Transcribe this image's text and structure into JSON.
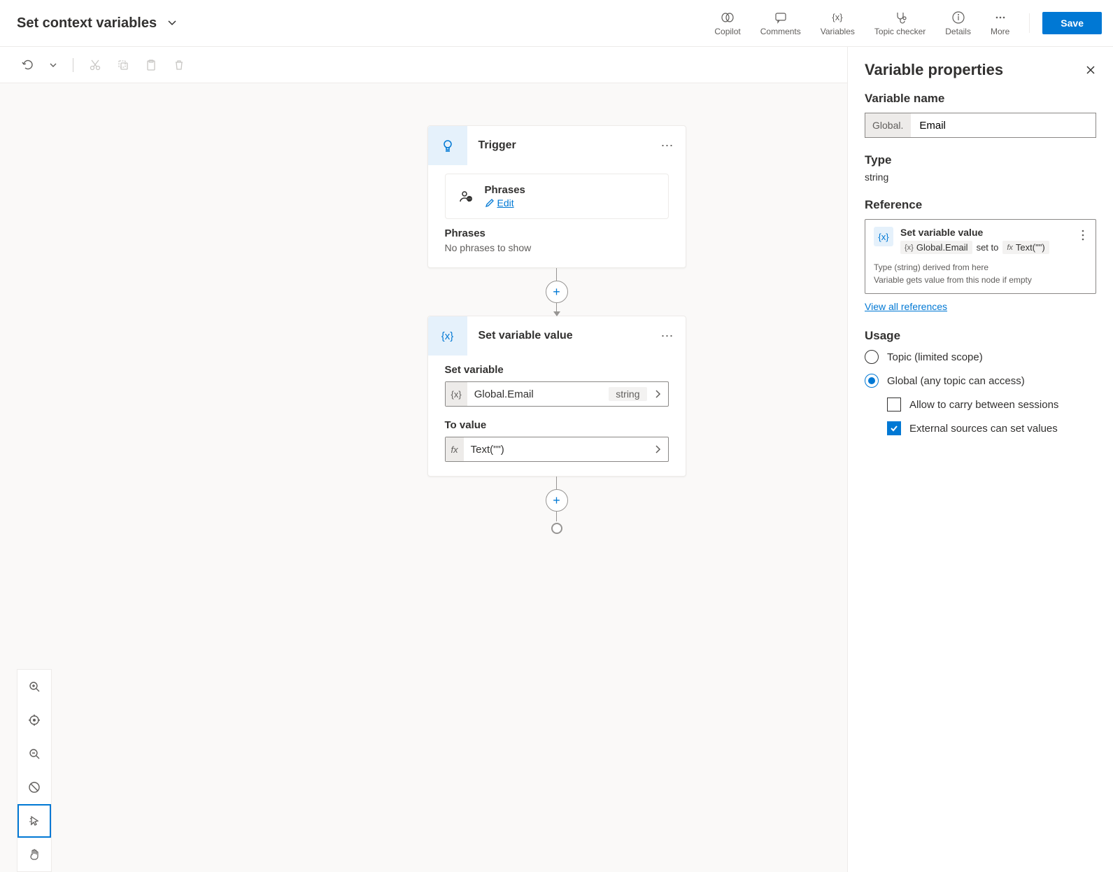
{
  "header": {
    "title": "Set context variables",
    "actions": {
      "copilot": "Copilot",
      "comments": "Comments",
      "variables": "Variables",
      "topic_checker": "Topic checker",
      "details": "Details",
      "more": "More",
      "save": "Save"
    }
  },
  "flow": {
    "trigger": {
      "title": "Trigger",
      "phrases_label": "Phrases",
      "edit": "Edit",
      "empty_title": "Phrases",
      "empty_msg": "No phrases to show"
    },
    "set_var": {
      "title": "Set variable value",
      "set_label": "Set variable",
      "var_name": "Global.Email",
      "var_type": "string",
      "to_label": "To value",
      "to_value": "Text(\"\")"
    }
  },
  "panel": {
    "title": "Variable properties",
    "name_label": "Variable name",
    "name_prefix": "Global.",
    "name_value": "Email",
    "type_label": "Type",
    "type_value": "string",
    "ref_label": "Reference",
    "ref_title": "Set variable value",
    "ref_var": "Global.Email",
    "ref_setto": "set to",
    "ref_expr": "Text(\"\")",
    "ref_meta1": "Type (string) derived from here",
    "ref_meta2": "Variable gets value from this node if empty",
    "view_all": "View all references",
    "usage_label": "Usage",
    "usage_topic": "Topic (limited scope)",
    "usage_global": "Global (any topic can access)",
    "usage_carry": "Allow to carry between sessions",
    "usage_external": "External sources can set values"
  }
}
